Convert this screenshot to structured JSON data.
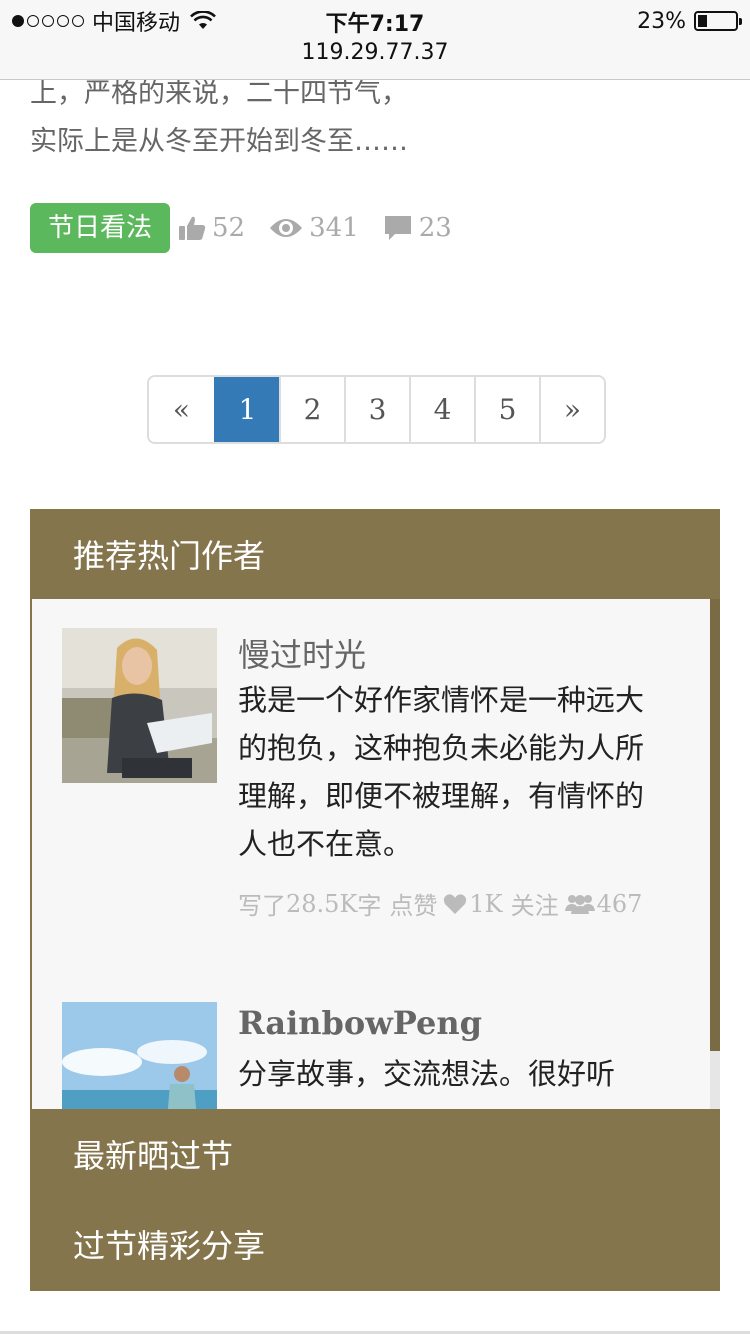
{
  "status_bar": {
    "carrier": "中国移动",
    "time": "下午7:17",
    "url": "119.29.77.37",
    "battery": "23%",
    "battery_level": 0.23
  },
  "article": {
    "excerpt_lines": [
      "上，严格的来说，二十四节气，",
      "实际上是从冬至开始到冬至……"
    ],
    "tag": "节日看法",
    "likes": "52",
    "views": "341",
    "comments": "23"
  },
  "pagination": {
    "prev": "«",
    "pages": [
      "1",
      "2",
      "3",
      "4",
      "5"
    ],
    "next": "»",
    "active_page": "1"
  },
  "hot_authors": {
    "title": "推荐热门作者",
    "authors": [
      {
        "name": "慢过时光",
        "description": "我是一个好作家情怀是一种远大的抱负，这种抱负未必能为人所理解，即便不被理解，有情怀的人也不在意。",
        "written_label": "写了",
        "written": "28.5K",
        "written_unit": "字",
        "likes_label": "点赞",
        "likes": "1K",
        "follow_label": "关注",
        "followers": "467"
      },
      {
        "name": "RainbowPeng",
        "description": "分享故事，交流想法。很好听"
      }
    ]
  },
  "menu": {
    "items": [
      "最新晒过节",
      "过节精彩分享"
    ]
  },
  "colors": {
    "panel_brown": "#85754d",
    "tag_green": "#5cb85c",
    "active_blue": "#337ab7"
  }
}
